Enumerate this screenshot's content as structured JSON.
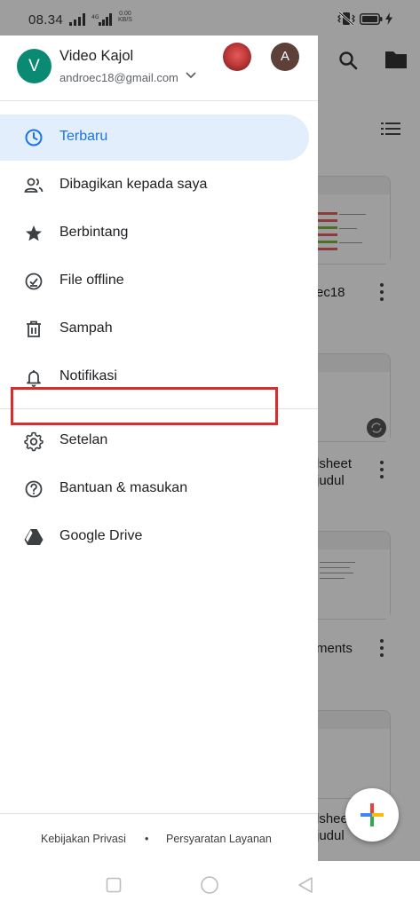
{
  "status_bar": {
    "time": "08.34",
    "net_speed_value": "0.00",
    "net_speed_unit": "KB/S",
    "icons": [
      "signal-icon",
      "signal-4g-icon",
      "mute-vibrate-icon",
      "battery-icon",
      "charging-icon"
    ]
  },
  "account": {
    "avatar_letter": "V",
    "name": "Video Kajol",
    "email": "androec18@gmail.com",
    "other_avatar_letter": "A",
    "colors": {
      "avatar": "#0b8a73",
      "other_avatar": "#5d4037"
    }
  },
  "nav": {
    "items": [
      {
        "label": "Terbaru",
        "icon": "clock-icon",
        "active": true
      },
      {
        "label": "Dibagikan kepada saya",
        "icon": "people-icon",
        "active": false
      },
      {
        "label": "Berbintang",
        "icon": "star-icon",
        "active": false
      },
      {
        "label": "File offline",
        "icon": "offline-check-icon",
        "active": false
      },
      {
        "label": "Sampah",
        "icon": "trash-icon",
        "active": false
      },
      {
        "label": "Notifikasi",
        "icon": "bell-icon",
        "active": false
      }
    ],
    "secondary": [
      {
        "label": "Setelan",
        "icon": "gear-icon"
      },
      {
        "label": "Bantuan & masukan",
        "icon": "help-icon"
      },
      {
        "label": "Google Drive",
        "icon": "google-drive-icon"
      }
    ],
    "active_color": "#1a73e8",
    "active_bg": "#e3eefc",
    "highlight_color": "#d32f2f"
  },
  "footer": {
    "privacy": "Kebijakan Privasi",
    "separator": "•",
    "terms": "Persyaratan Layanan"
  },
  "background": {
    "files": [
      {
        "label": "ec18"
      },
      {
        "label": "lsheet\njudul"
      },
      {
        "label": "ments"
      },
      {
        "label": "lshee\njudul"
      }
    ],
    "icons": [
      "search-icon",
      "folder-icon",
      "list-view-icon",
      "sync-icon",
      "add-icon"
    ]
  }
}
